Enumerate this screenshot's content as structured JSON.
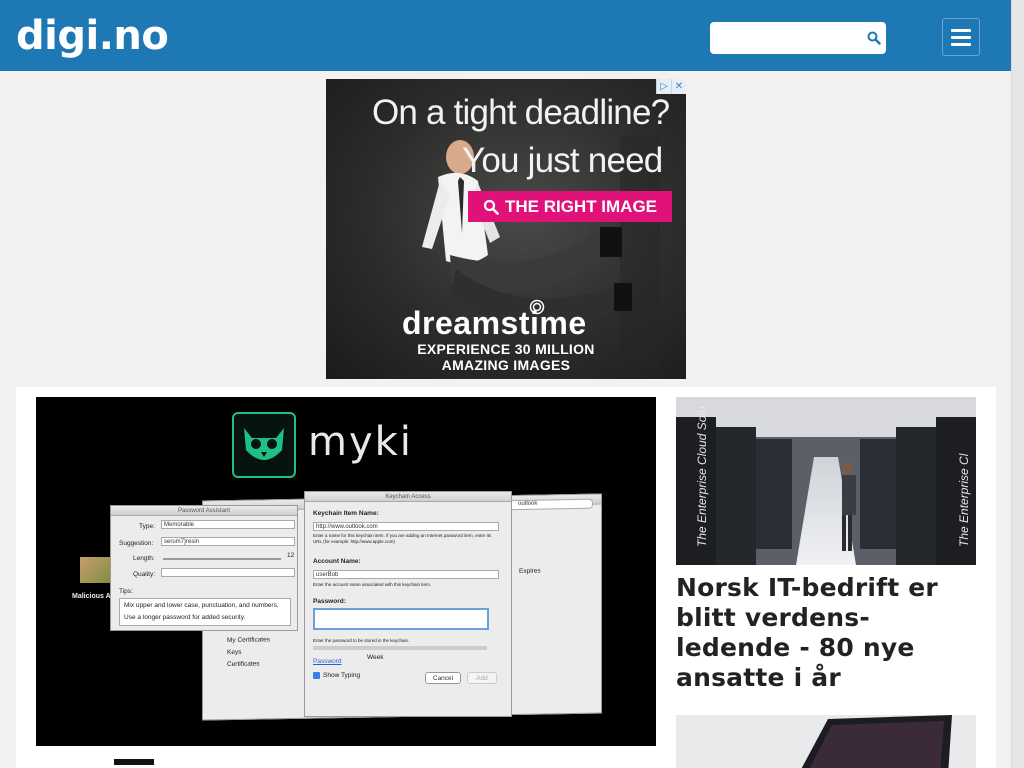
{
  "header": {
    "logo": "digi.no",
    "search": {
      "placeholder": "",
      "value": ""
    },
    "colors": {
      "brand": "#1d78b4"
    }
  },
  "ad": {
    "headline_1": "On a tight deadline?",
    "headline_2": "You just need",
    "cta": "THE RIGHT IMAGE",
    "brand": "dreamstime",
    "subline_1": "EXPERIENCE 30 MILLION",
    "subline_2": "AMAZING IMAGES",
    "badge_info": "▷",
    "badge_close": "✕",
    "colors": {
      "cta": "#e0127a"
    }
  },
  "main_article": {
    "image": {
      "brand": "myki",
      "keychain_window_title": "Keychain Access",
      "assistant_window_title": "Password Assistant",
      "search_text": "outlook",
      "type_label": "Type:",
      "type_value": "Memorable",
      "suggestion_label": "Suggestion:",
      "suggestion_value": "serum7}resin",
      "length_label": "Length:",
      "length_value": "12",
      "quality_label": "Quality:",
      "tips_label": "Tips:",
      "tips_text_1": "Mix upper and lower case, punctuation, and numbers.",
      "tips_text_2": "Use a longer password for added security.",
      "item_name_label": "Keychain Item Name:",
      "item_name_value": "http://www.outlook.com",
      "item_name_hint": "Enter a name for this keychain item. If you are adding an Internet password item, enter its URL (for example: http://www.apple.com)",
      "account_label": "Account Name:",
      "account_value": "userBob",
      "account_hint": "Enter the account name associated with this keychain item.",
      "password_label": "Password:",
      "password_hint": "Enter the password to be stored in the keychain.",
      "password_link": "Password",
      "strength_label": "Week",
      "show_typing": "Show Typing",
      "cancel": "Cancel",
      "add": "Add",
      "expires": "Expires",
      "malicious": "Malicious A",
      "sidebar_items": [
        "My Certificates",
        "Keys",
        "Certificates"
      ]
    }
  },
  "side_article": {
    "title": "Norsk IT-bedrift er blitt verdens-ledende - 80 nye ansatte i år",
    "image_text": "The Enterprise Cloud Solution"
  }
}
